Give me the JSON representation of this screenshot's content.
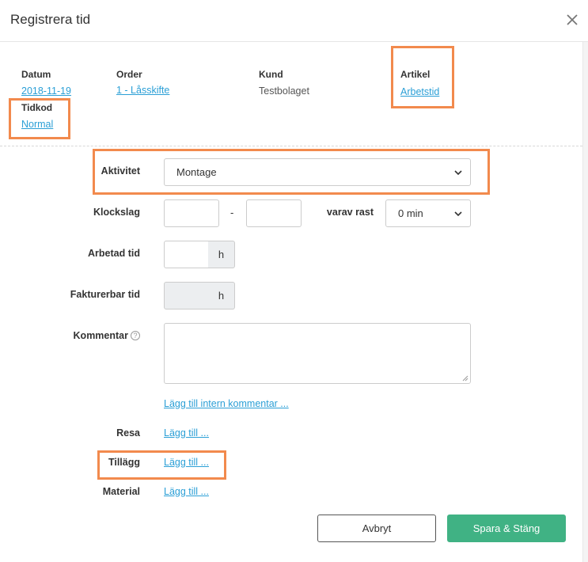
{
  "dialog": {
    "title": "Registrera tid",
    "close_icon": "close-icon"
  },
  "info": {
    "datum_label": "Datum",
    "datum_value": "2018-11-19",
    "order_label": "Order",
    "order_value": "1 - Låsskifte",
    "kund_label": "Kund",
    "kund_value": "Testbolaget",
    "artikel_label": "Artikel",
    "artikel_value": "Arbetstid",
    "tidkod_label": "Tidkod",
    "tidkod_value": "Normal"
  },
  "form": {
    "aktivitet_label": "Aktivitet",
    "aktivitet_value": "Montage",
    "klockslag_label": "Klockslag",
    "klockslag_separator": "-",
    "rast_label": "varav rast",
    "rast_value": "0 min",
    "arbetad_label": "Arbetad tid",
    "arbetad_unit": "h",
    "fakturerbar_label": "Fakturerbar tid",
    "fakturerbar_unit": "h",
    "kommentar_label": "Kommentar",
    "help_glyph": "?",
    "intern_link": "Lägg till intern kommentar ...",
    "resa_label": "Resa",
    "resa_link": "Lägg till ...",
    "tillagg_label": "Tillägg",
    "tillagg_link": "Lägg till ...",
    "material_label": "Material",
    "material_link": "Lägg till ..."
  },
  "footer": {
    "cancel_label": "Avbryt",
    "save_label": "Spara & Stäng"
  },
  "colors": {
    "link": "#2b9fd6",
    "highlight": "#f28a4d",
    "primary": "#40b284"
  }
}
